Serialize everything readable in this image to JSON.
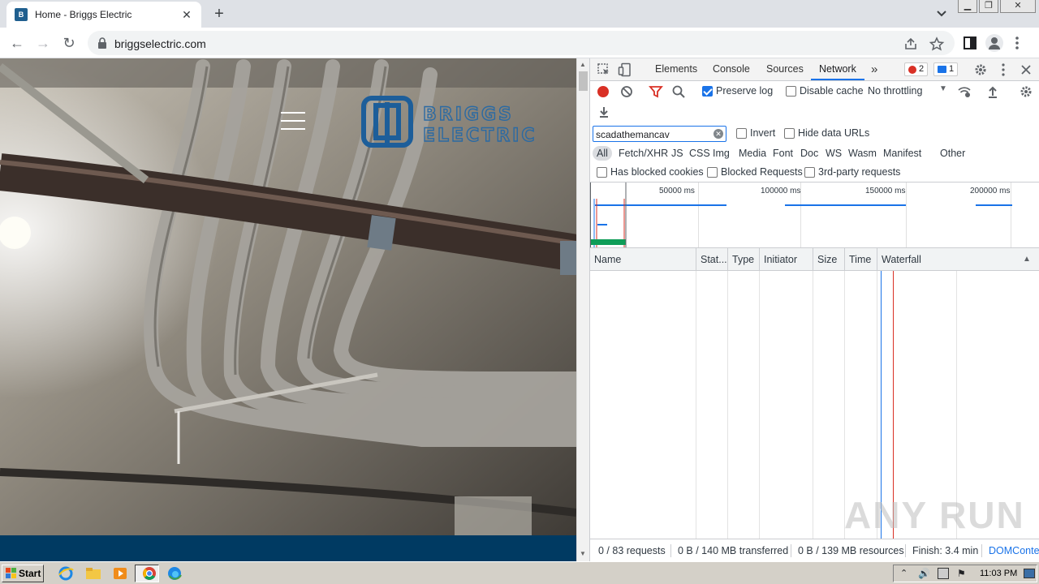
{
  "browser": {
    "tab": {
      "title": "Home - Briggs Electric",
      "favicon_text": "B"
    },
    "new_tab_label": "+",
    "address": "briggselectric.com",
    "window_controls": [
      "minimize",
      "restore",
      "close"
    ]
  },
  "devtools": {
    "tabs": [
      "Elements",
      "Console",
      "Sources",
      "Network"
    ],
    "active_tab": "Network",
    "more_tabs": "»",
    "errors_count": "2",
    "messages_count": "1",
    "preserve_log_label": "Preserve log",
    "disable_cache_label": "Disable cache",
    "throttling": "No throttling",
    "filter_value": "scadathemancav",
    "invert_label": "Invert",
    "hide_data_urls_label": "Hide data URLs",
    "type_filters": [
      "All",
      "Fetch/XHR",
      "JS",
      "CSS",
      "Img",
      "Media",
      "Font",
      "Doc",
      "WS",
      "Wasm",
      "Manifest",
      "Other"
    ],
    "has_blocked_cookies_label": "Has blocked cookies",
    "blocked_requests_label": "Blocked Requests",
    "third_party_label": "3rd-party requests",
    "overview_ticks": [
      "50000 ms",
      "100000 ms",
      "150000 ms",
      "200000 ms"
    ],
    "columns": [
      "Name",
      "Stat...",
      "Type",
      "Initiator",
      "Size",
      "Time",
      "Waterfall"
    ],
    "status": {
      "requests": "0 / 83 requests",
      "transferred": "0 B / 140 MB transferred",
      "resources": "0 B / 139 MB resources",
      "finish": "Finish: 3.4 min",
      "domcontent": "DOMConte"
    }
  },
  "watermark": "ANY RUN",
  "taskbar": {
    "start_label": "Start",
    "clock": "11:03 PM"
  },
  "colors": {
    "site_band": "#003a62",
    "accent": "#1a73e8",
    "record": "#d93025"
  }
}
